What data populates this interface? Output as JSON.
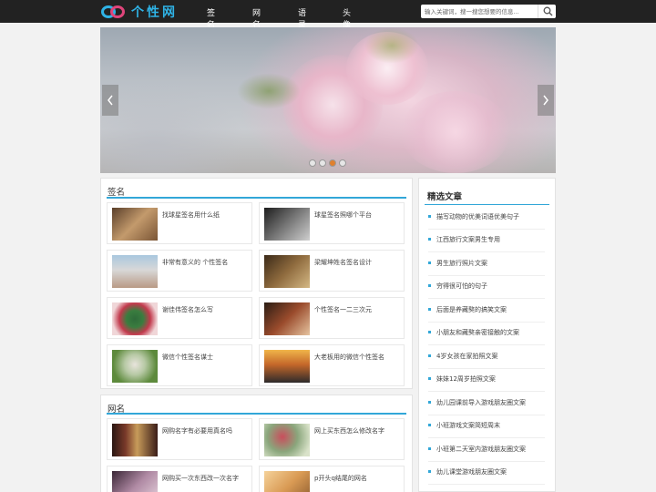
{
  "header": {
    "logo_text": "个性网",
    "nav": [
      {
        "label": "签名"
      },
      {
        "label": "网名"
      },
      {
        "label": "语录"
      },
      {
        "label": "头像"
      }
    ],
    "search_placeholder": "输入关键词，搜一搜您想要的信息..."
  },
  "banner": {
    "dots": 4,
    "active_dot": 3
  },
  "sections": [
    {
      "title": "签名",
      "items": [
        {
          "title": "找球星签名用什么纸"
        },
        {
          "title": "球星签名照哪个平台"
        },
        {
          "title": "非常有意义的 个性签名"
        },
        {
          "title": "梁耀坤姓名签名设计"
        },
        {
          "title": "谢佳伟签名怎么写"
        },
        {
          "title": "个性签名一二三次元"
        },
        {
          "title": "微信个性签名谋士"
        },
        {
          "title": "大老板用的微信个性签名"
        }
      ]
    },
    {
      "title": "网名",
      "items": [
        {
          "title": "网购名字有必要用真名吗"
        },
        {
          "title": "网上买东西怎么修改名字"
        },
        {
          "title": "网购买一次东西改一次名字"
        },
        {
          "title": "p开头q结尾的网名"
        }
      ]
    }
  ],
  "sidebar": {
    "title": "精选文章",
    "articles": [
      "描写动物的优美词语优美句子",
      "江西旅行文案男生专用",
      "男生旅行照片文案",
      "穷得很可怕的句子",
      "后面是养藏獒的搞笑文案",
      "小朋友和藏獒亲密接触的文案",
      "4岁女孩在家拍照文案",
      "妹妹12周岁拍照文案",
      "幼儿园课前导入游戏朋友圈文案",
      "小班游戏文案简短周末",
      "小班第二天室内游戏朋友圈文案",
      "幼儿课堂游戏朋友圈文案"
    ]
  },
  "colors": {
    "accent": "#32a7d8",
    "header_bg": "#222222",
    "logo_blue": "#2fb3e6",
    "logo_pink": "#e0457b",
    "active_dot": "#e0802e"
  },
  "icons": {
    "search": "search-icon",
    "prev": "chevron-left-icon",
    "next": "chevron-right-icon"
  }
}
